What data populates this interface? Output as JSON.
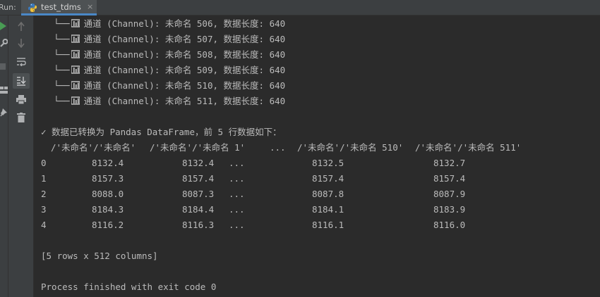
{
  "run_label": "Run:",
  "tab": {
    "label": "test_tdms",
    "close": "×"
  },
  "toolbar": {
    "left_icons": [
      "run-icon",
      "wrench-icon",
      "stop-icon",
      "layout-icon",
      "pin-icon"
    ],
    "icons": [
      "arrow-up-icon",
      "arrow-down-icon",
      "soft-wrap-icon",
      "scroll-to-end-icon",
      "print-icon",
      "trash-icon"
    ]
  },
  "colors": {
    "accent": "#4a88c7",
    "run_green": "#499c54",
    "text": "#bbbbbb",
    "background": "#2b2b2b"
  },
  "console": {
    "tree_prefix": "└──",
    "channels": [
      "通道 (Channel): 未命名 506, 数据长度: 640",
      "通道 (Channel): 未命名 507, 数据长度: 640",
      "通道 (Channel): 未命名 508, 数据长度: 640",
      "通道 (Channel): 未命名 509, 数据长度: 640",
      "通道 (Channel): 未命名 510, 数据长度: 640",
      "通道 (Channel): 未命名 511, 数据长度: 640"
    ],
    "converted_msg": "✓ 数据已转换为 Pandas DataFrame，前 5 行数据如下：",
    "table": {
      "header": [
        "/'未命名'/'未命名'",
        "/'未命名'/'未命名 1'",
        "...",
        "/'未命名'/'未命名 510'",
        "/'未命名'/'未命名 511'"
      ],
      "rows": [
        [
          "0",
          "8132.4",
          "8132.4",
          "...",
          "8132.5",
          "8132.7"
        ],
        [
          "1",
          "8157.3",
          "8157.4",
          "...",
          "8157.4",
          "8157.4"
        ],
        [
          "2",
          "8088.0",
          "8087.3",
          "...",
          "8087.8",
          "8087.9"
        ],
        [
          "3",
          "8184.3",
          "8184.4",
          "...",
          "8184.1",
          "8183.9"
        ],
        [
          "4",
          "8116.2",
          "8116.3",
          "...",
          "8116.1",
          "8116.0"
        ]
      ]
    },
    "shape": "[5 rows x 512 columns]",
    "exit_msg": "Process finished with exit code 0"
  }
}
